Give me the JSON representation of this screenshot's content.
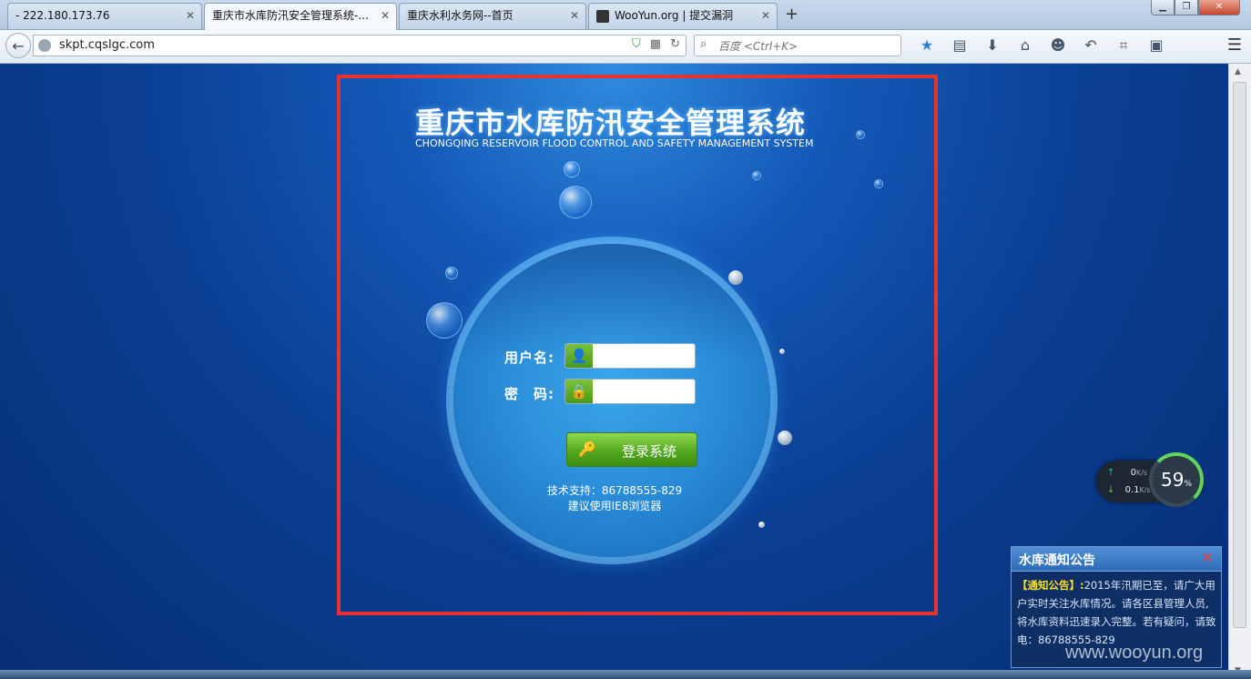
{
  "browser": {
    "tabs": [
      {
        "label": "- 222.180.173.76",
        "active": false
      },
      {
        "label": "重庆市水库防汛安全管理系统-...",
        "active": true
      },
      {
        "label": "重庆水利水务网--首页",
        "active": false
      },
      {
        "label": "WooYun.org | 提交漏洞",
        "active": false
      }
    ],
    "new_tab": "+",
    "url": "skpt.cqslgc.com",
    "search_placeholder": "百度 <Ctrl+K>"
  },
  "header": {
    "title": "重庆市水库防汛安全管理系统",
    "subtitle": "CHONGQING RESERVOIR FLOOD CONTROL AND SAFETY MANAGEMENT SYSTEM"
  },
  "login": {
    "username_label": "用户名:",
    "password_label": "密　码:",
    "username_value": "",
    "password_value": "",
    "submit_label": "登录系统",
    "support": "技术支持：86788555-829",
    "browser_tip": "建议使用IE8浏览器"
  },
  "speed_widget": {
    "up": "0",
    "down": "0.1",
    "unit": "K/s",
    "percent": "59",
    "percent_sign": "%"
  },
  "notice": {
    "title": "水库通知公告",
    "tag": "【通知公告】:",
    "body": "2015年汛期已至，请广大用户实时关注水库情况。请各区县管理人员,将水库资料迅速录入完整。若有疑问，请致电：86788555-829"
  },
  "watermark": "www.wooyun.org"
}
